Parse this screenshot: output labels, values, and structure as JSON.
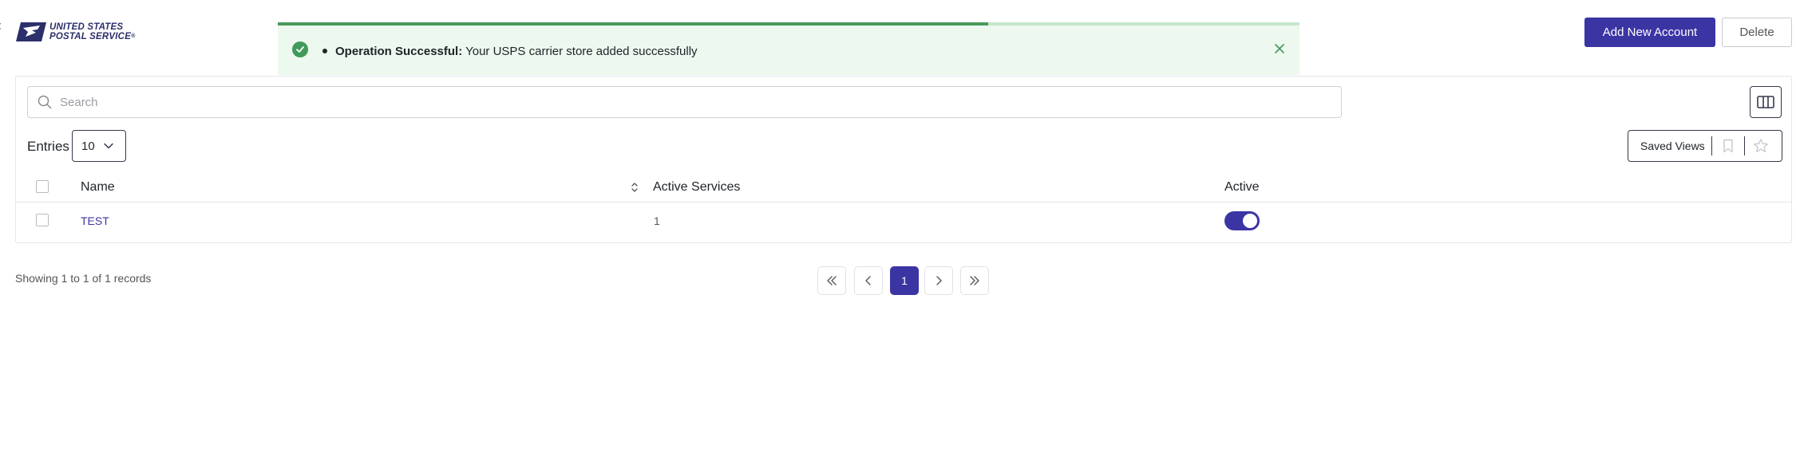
{
  "header": {
    "logo_line1": "UNITED STATES",
    "logo_line2": "POSTAL SERVICE",
    "logo_mark": "®"
  },
  "toast": {
    "title": "Operation Successful:",
    "message": " Your USPS carrier store added successfully",
    "progress_fraction": 0.695,
    "accent_color": "#4a9a5a",
    "icon": "check-circle-icon",
    "close_icon": "close-icon"
  },
  "actions": {
    "add_label": "Add New Account",
    "delete_label": "Delete",
    "primary_color": "#3b35a4"
  },
  "search": {
    "placeholder": "Search",
    "value": ""
  },
  "toolbar": {
    "entries_label": "Entries",
    "entries_value": "10",
    "saved_views_label": "Saved Views",
    "icons": [
      "columns-icon",
      "bookmark-icon",
      "star-icon",
      "chevron-down-icon",
      "search-icon"
    ]
  },
  "table": {
    "columns": [
      "Name",
      "Active Services",
      "Active"
    ],
    "rows": [
      {
        "name": "TEST",
        "active_services": "1",
        "active": true
      }
    ]
  },
  "footer": {
    "records_text": "Showing 1 to 1 of 1 records",
    "current_page": "1",
    "pager_icons": [
      "first-page-icon",
      "prev-page-icon",
      "next-page-icon",
      "last-page-icon"
    ]
  }
}
